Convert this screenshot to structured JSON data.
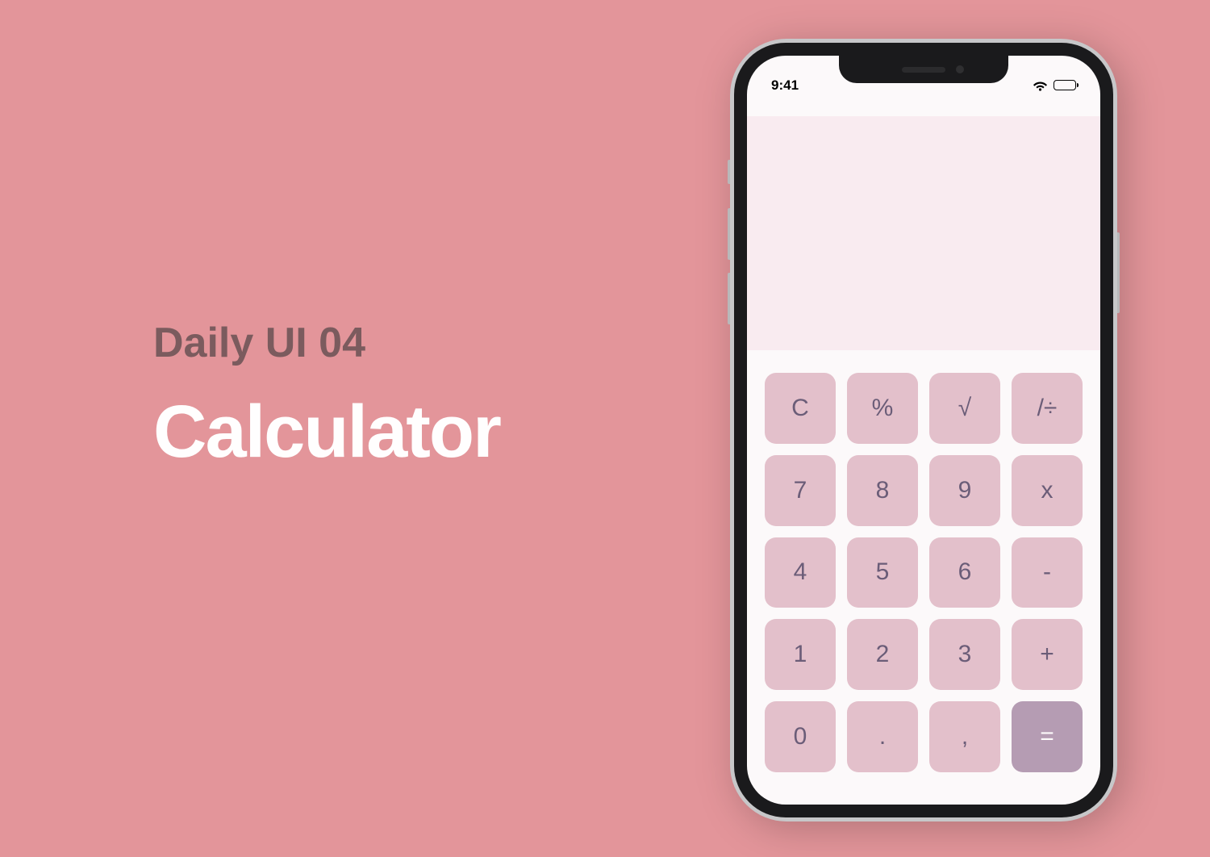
{
  "page": {
    "subtitle": "Daily UI 04",
    "title": "Calculator"
  },
  "status_bar": {
    "time": "9:41"
  },
  "calculator": {
    "display": "",
    "keys": [
      {
        "name": "key-clear",
        "label": "C",
        "type": "function"
      },
      {
        "name": "key-percent",
        "label": "%",
        "type": "function"
      },
      {
        "name": "key-sqrt",
        "label": "√",
        "type": "function"
      },
      {
        "name": "key-divide",
        "label": "/÷",
        "type": "operator"
      },
      {
        "name": "key-7",
        "label": "7",
        "type": "digit"
      },
      {
        "name": "key-8",
        "label": "8",
        "type": "digit"
      },
      {
        "name": "key-9",
        "label": "9",
        "type": "digit"
      },
      {
        "name": "key-multiply",
        "label": "x",
        "type": "operator"
      },
      {
        "name": "key-4",
        "label": "4",
        "type": "digit"
      },
      {
        "name": "key-5",
        "label": "5",
        "type": "digit"
      },
      {
        "name": "key-6",
        "label": "6",
        "type": "digit"
      },
      {
        "name": "key-subtract",
        "label": "-",
        "type": "operator"
      },
      {
        "name": "key-1",
        "label": "1",
        "type": "digit"
      },
      {
        "name": "key-2",
        "label": "2",
        "type": "digit"
      },
      {
        "name": "key-3",
        "label": "3",
        "type": "digit"
      },
      {
        "name": "key-add",
        "label": "+",
        "type": "operator"
      },
      {
        "name": "key-0",
        "label": "0",
        "type": "digit"
      },
      {
        "name": "key-dot",
        "label": ".",
        "type": "digit"
      },
      {
        "name": "key-comma",
        "label": ",",
        "type": "digit"
      },
      {
        "name": "key-equals",
        "label": "=",
        "type": "equals"
      }
    ]
  },
  "colors": {
    "background": "#E3959A",
    "subtitle_text": "#7B5B5E",
    "title_text": "#FFFEFE",
    "screen_bg": "#FCF9FA",
    "display_bg": "#F9EBF0",
    "key_bg": "#E3C0CB",
    "key_text": "#6B5D78",
    "equals_bg": "#B59CB3"
  }
}
